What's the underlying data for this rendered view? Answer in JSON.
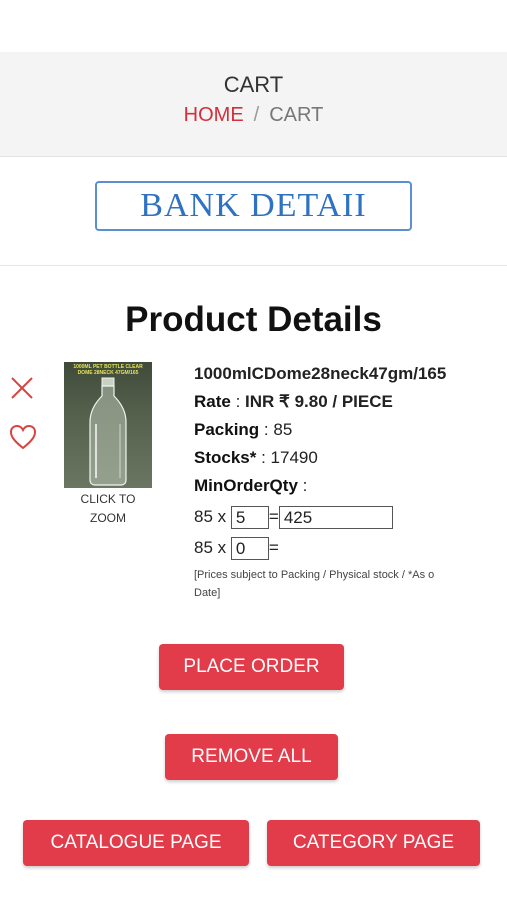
{
  "header": {
    "title": "CART",
    "breadcrumb_home": "HOME",
    "breadcrumb_sep": "/",
    "breadcrumb_current": "CART"
  },
  "bank_button": {
    "label": "BANK DETAII"
  },
  "product_section": {
    "title": "Product Details",
    "image_label": "1000ML PET BOTTLE CLEAR DOME 28NECK 47GM/165",
    "zoom_text": "CLICK TO ZOOM",
    "name": "1000mlCDome28neck47gm/165",
    "rate_label": "Rate",
    "rate_value": "INR ₹ 9.80 / PIECE",
    "packing_label": "Packing",
    "packing_value": "85",
    "stocks_label": "Stocks*",
    "stocks_value": "17490",
    "moq_label": "MinOrderQty",
    "moq_value": "",
    "qty_row1": {
      "multiplier": "85 x",
      "qty": "5",
      "equals": "=",
      "total": "425"
    },
    "qty_row2": {
      "multiplier": "85 x",
      "qty": "0",
      "equals": "=",
      "total": ""
    },
    "note_line1": "[Prices subject to Packing / Physical stock / *As o",
    "note_line2": "Date]"
  },
  "buttons": {
    "place_order": "PLACE ORDER",
    "remove_all": "REMOVE ALL",
    "catalogue_page": "CATALOGUE PAGE",
    "category_page": "CATEGORY PAGE"
  },
  "colors": {
    "accent_red": "#e23b4a",
    "breadcrumb_red": "#d32f3a",
    "bank_blue": "#2f72c2"
  },
  "icons": {
    "remove": "close-icon",
    "wishlist": "heart-icon"
  }
}
